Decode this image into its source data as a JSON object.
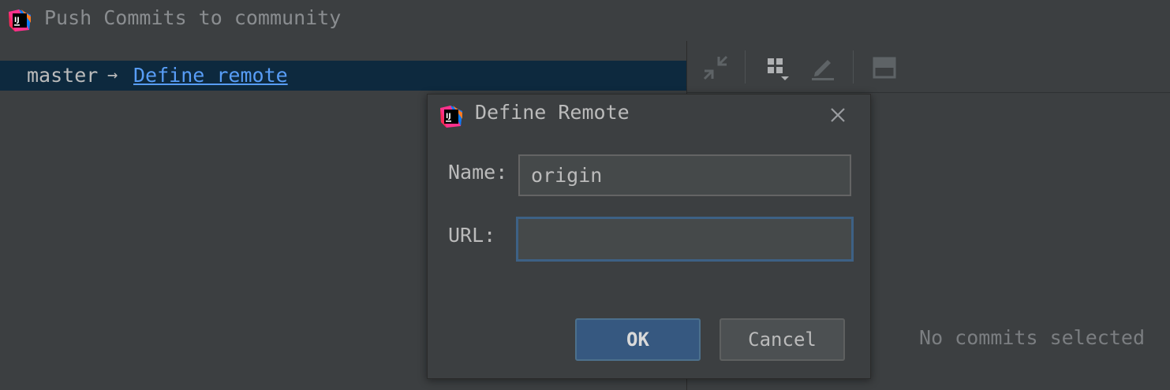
{
  "window": {
    "title": "Push Commits to community",
    "app_icon": "intellij-idea-icon"
  },
  "branch_row": {
    "branch": "master",
    "arrow": "→",
    "define_remote_link": "Define remote"
  },
  "right_panel": {
    "toolbar_icons": [
      "collapse-icon",
      "group-by-icon",
      "edit-icon",
      "layout-icon"
    ],
    "empty_text": "No commits selected"
  },
  "dialog": {
    "title": "Define Remote",
    "name_label": "Name:",
    "name_value": "origin",
    "url_label": "URL:",
    "url_value": "",
    "ok_label": "OK",
    "cancel_label": "Cancel"
  },
  "colors": {
    "background": "#3c3f41",
    "selection_row": "#0d293e",
    "link": "#589df6",
    "ok_button": "#365880",
    "focus_border": "#3d6185"
  }
}
